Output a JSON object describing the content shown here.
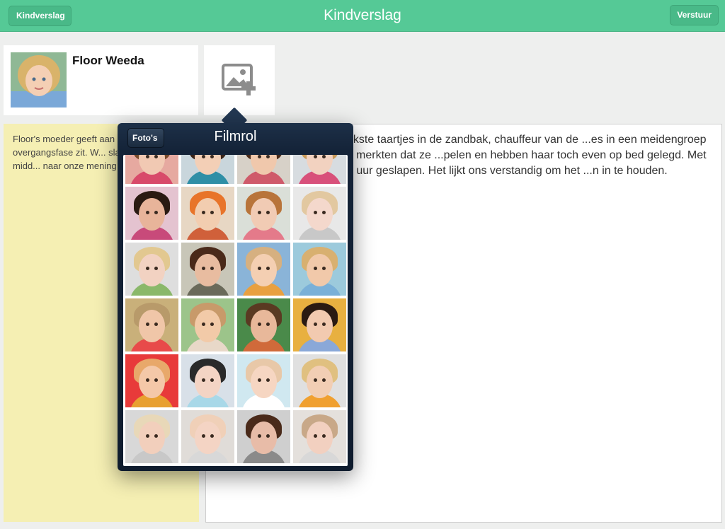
{
  "navbar": {
    "title": "Kindverslag",
    "back_label": "Kindverslag",
    "action_label": "Verstuur"
  },
  "child": {
    "name": "Floor Weeda"
  },
  "notes": {
    "text": "Floor's moeder geeft aan dat Floor in een overgangsfase zit. W... slaapje meer in de midd... naar onze mening"
  },
  "report": {
    "text": "...was bakker van de heerlijkste taartjes in de zandbak, chauffeur van de ...es in een meidengroep met Daphne en Merlijn. We merkten dat ze ...pelen en hebben haar toch even op bed gelegd. Met een verhaaltje ...e heeft 1,5 uur geslapen. Het lijkt ons verstandig om het ...n in te houden."
  },
  "popover": {
    "title": "Filmrol",
    "back_label": "Foto's"
  },
  "colors": {
    "accent": "#55c996",
    "note_background": "#f5efb3",
    "popover": "#142338"
  },
  "icons": {
    "add_photo": "add-photo-icon"
  }
}
